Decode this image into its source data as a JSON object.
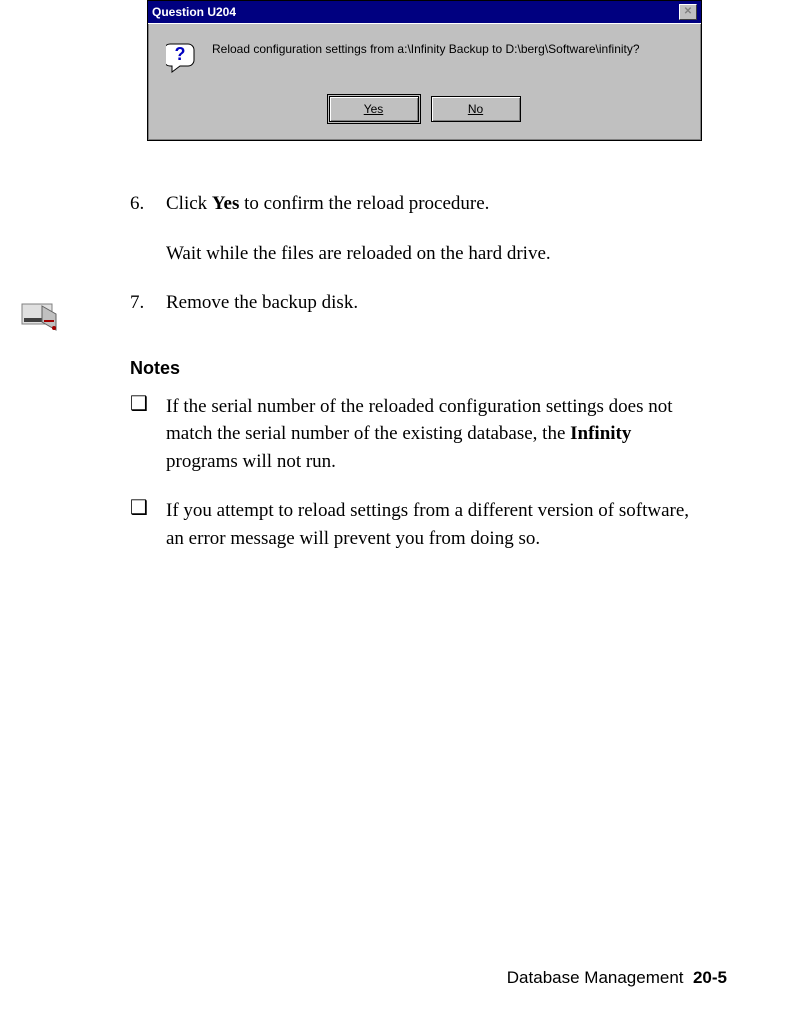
{
  "dialog": {
    "title": "Question U204",
    "message": "Reload configuration settings from a:\\Infinity Backup to D:\\berg\\Software\\infinity?",
    "yes": "Yes",
    "no": "No"
  },
  "steps": {
    "s6_num": "6.",
    "s6_a": "Click ",
    "s6_bold": "Yes",
    "s6_b": " to confirm the reload procedure.",
    "s6_sub": "Wait while the files are reloaded on the hard drive.",
    "s7_num": "7.",
    "s7_text": "Remove the backup disk."
  },
  "notes": {
    "heading": "Notes",
    "n1_a": "If the serial number of the reloaded configuration settings does not match the serial number of the existing database, the ",
    "n1_bold": "Infinity",
    "n1_b": " programs will not run.",
    "n2": "If you attempt to reload settings from a different version of software, an error message will prevent you from doing so."
  },
  "footer": {
    "section": "Database Management",
    "page": "20-5"
  }
}
